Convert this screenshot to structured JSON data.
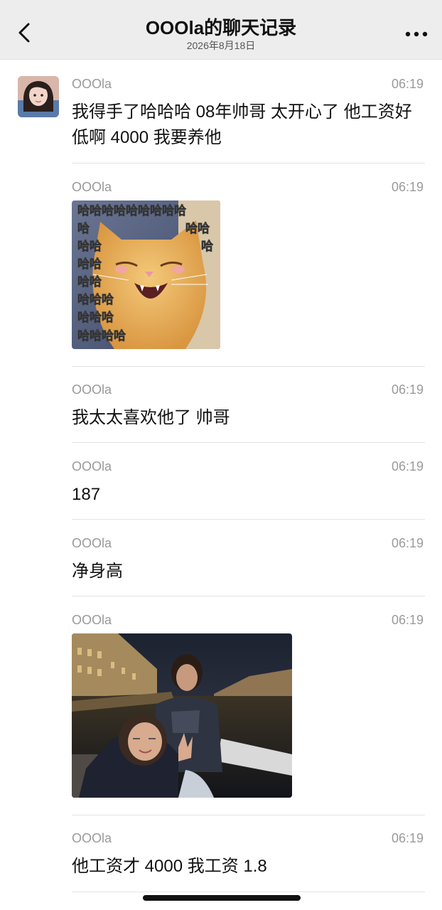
{
  "header": {
    "title": "OOOla的聊天记录",
    "date": "2026年8月18日"
  },
  "messages": [
    {
      "sender": "OOOla",
      "time": "06:19",
      "type": "text",
      "text": "我得手了哈哈哈 08年帅哥 太开心了 他工资好低啊 4000 我要养他"
    },
    {
      "sender": "OOOla",
      "time": "06:19",
      "type": "image",
      "image_desc": "cat-laughing-meme",
      "overlay_text": [
        "哈哈哈哈哈哈哈哈哈",
        "哈",
        "哈哈",
        "哈哈",
        "哈",
        "哈哈",
        "哈哈",
        "哈哈哈",
        "哈哈哈",
        "哈哈哈哈"
      ]
    },
    {
      "sender": "OOOla",
      "time": "06:19",
      "type": "text",
      "text": "我太太喜欢他了 帅哥"
    },
    {
      "sender": "OOOla",
      "time": "06:19",
      "type": "text",
      "text": "187"
    },
    {
      "sender": "OOOla",
      "time": "06:19",
      "type": "text",
      "text": "净身高"
    },
    {
      "sender": "OOOla",
      "time": "06:19",
      "type": "image",
      "image_desc": "night-riverside-selfie-photo"
    },
    {
      "sender": "OOOla",
      "time": "06:19",
      "type": "text",
      "text": "他工资才 4000 我工资 1.8"
    }
  ],
  "colors": {
    "header_bg": "#ededed",
    "sender_gray": "#999999",
    "text": "#111111",
    "divider": "#e3e3e3"
  },
  "icons": [
    "back-chevron-icon",
    "more-dots-icon"
  ]
}
